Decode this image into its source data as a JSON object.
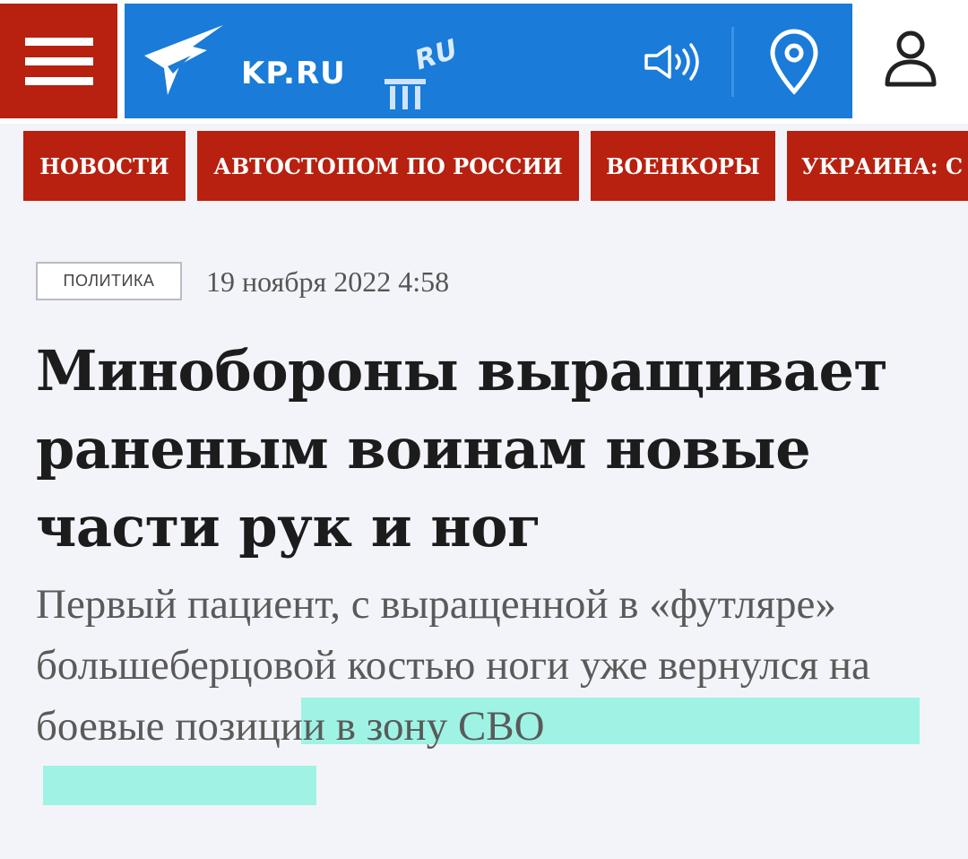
{
  "header": {
    "logo_text": "KP.RU",
    "logo_badge": "RU",
    "accent_color": "#b8200f",
    "brand_color": "#1a7bd8"
  },
  "nav": {
    "items": [
      {
        "label": "НОВОСТИ"
      },
      {
        "label": "АВТОСТОПОМ ПО РОССИИ"
      },
      {
        "label": "ВОЕНКОРЫ"
      },
      {
        "label": "УКРАИНА: С"
      }
    ]
  },
  "article": {
    "category": "ПОЛИТИКА",
    "date": "19 ноября 2022 4:58",
    "title": "Минобороны выращивает раненым воинам новые части рук и ног",
    "subtitle": "Первый пациент, с выращенной в «футляре» большеберцовой костью ноги уже вернулся на боевые позиции в зону СВО",
    "highlight_color": "#8ef2e0"
  }
}
